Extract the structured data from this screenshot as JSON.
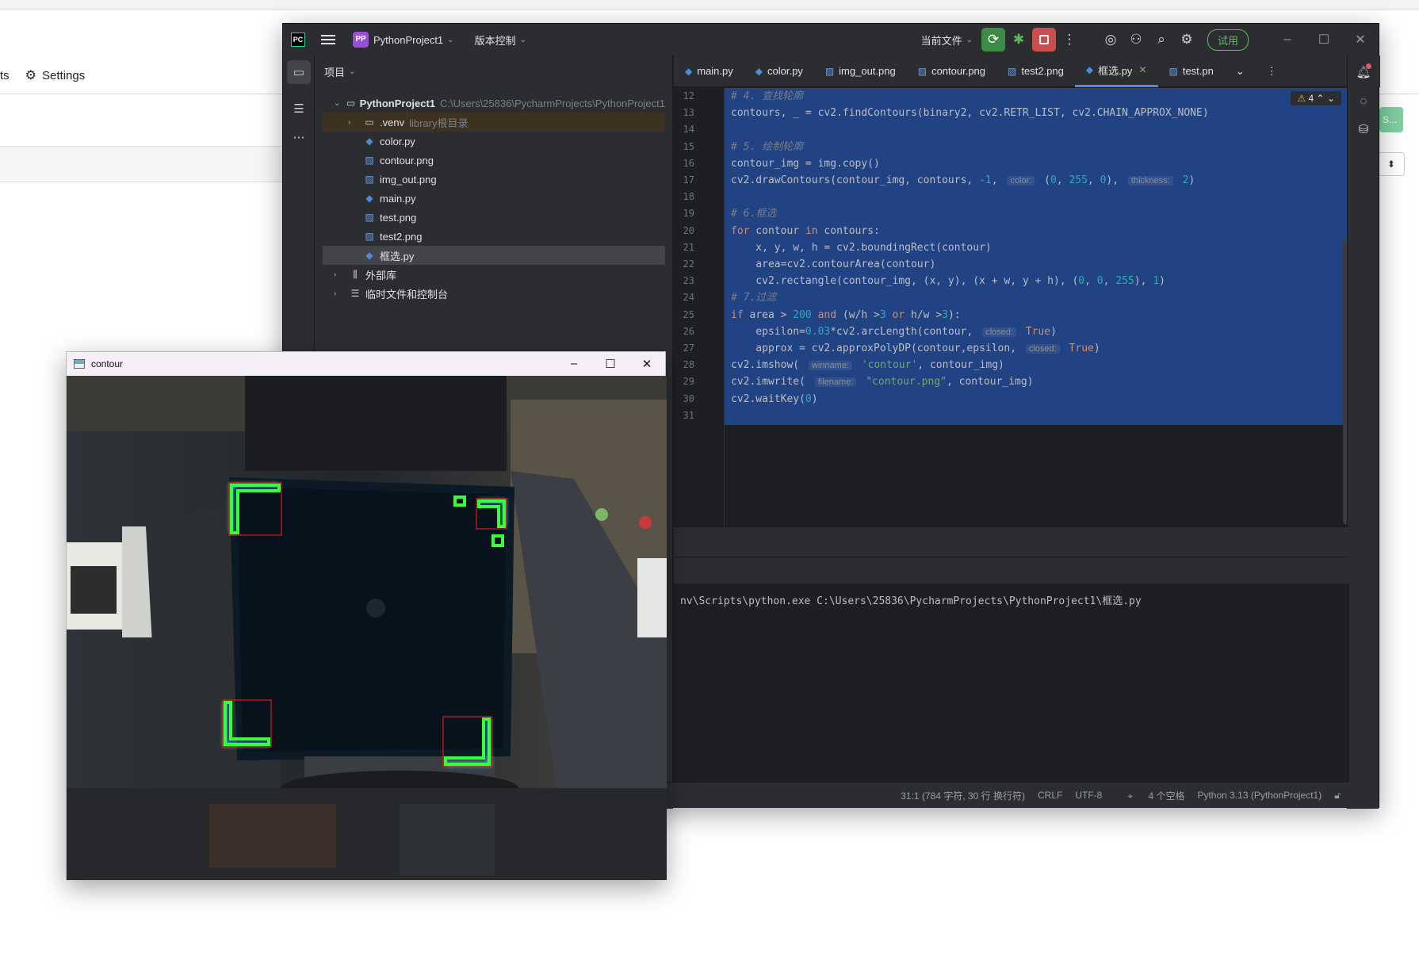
{
  "browser": {
    "nav_left": "ts",
    "nav_settings": "Settings",
    "green_btn": "S..."
  },
  "ide": {
    "logo": "PC",
    "project_badge": "PP",
    "project_name": "PythonProject1",
    "vcs": "版本控制",
    "run_config": "当前文件",
    "trial": "试用",
    "panel_title": "项目",
    "tree": [
      {
        "label": "PythonProject1",
        "path": "C:\\Users\\25836\\PycharmProjects\\PythonProject1",
        "type": "root"
      },
      {
        "label": ".venv",
        "extra": "library根目录",
        "type": "folder"
      },
      {
        "label": "color.py",
        "type": "py"
      },
      {
        "label": "contour.png",
        "type": "png"
      },
      {
        "label": "img_out.png",
        "type": "png"
      },
      {
        "label": "main.py",
        "type": "py"
      },
      {
        "label": "test.png",
        "type": "png"
      },
      {
        "label": "test2.png",
        "type": "png"
      },
      {
        "label": "框选.py",
        "type": "py"
      },
      {
        "label": "外部库",
        "type": "lib"
      },
      {
        "label": "临时文件和控制台",
        "type": "scratch"
      }
    ],
    "tabs": [
      {
        "label": "main.py",
        "type": "py"
      },
      {
        "label": "color.py",
        "type": "py"
      },
      {
        "label": "img_out.png",
        "type": "png"
      },
      {
        "label": "contour.png",
        "type": "png"
      },
      {
        "label": "test2.png",
        "type": "png"
      },
      {
        "label": "框选.py",
        "type": "py",
        "active": true
      },
      {
        "label": "test.pn",
        "type": "png"
      }
    ],
    "warnings": "4",
    "line_numbers": [
      "12",
      "13",
      "14",
      "15",
      "16",
      "17",
      "18",
      "19",
      "20",
      "21",
      "22",
      "23",
      "24",
      "25",
      "26",
      "27",
      "28",
      "29",
      "30",
      "31"
    ],
    "code": [
      "# 4. 查找轮廓",
      "contours, _ = cv2.findContours(binary2, cv2.RETR_LIST, cv2.CHAIN_APPROX_NONE)",
      "",
      "# 5. 绘制轮廓",
      "contour_img = img.copy()",
      "cv2.drawContours(contour_img, contours, -1, color: (0, 255, 0), thickness: 2)",
      "",
      "# 6.框选",
      "for contour in contours:",
      "    x, y, w, h = cv2.boundingRect(contour)",
      "    area=cv2.contourArea(contour)",
      "    cv2.rectangle(contour_img, (x, y), (x + w, y + h), (0, 0, 255), 1)",
      "# 7.过滤",
      "if area > 200 and (w/h >3 or h/w >3):",
      "    epsilon=0.03*cv2.arcLength(contour, closed: True)",
      "    approx = cv2.approxPolyDP(contour,epsilon, closed: True)",
      "cv2.imshow( winname: 'contour', contour_img)",
      "cv2.imwrite( filename: \"contour.png\", contour_img)",
      "cv2.waitKey(0)",
      ""
    ],
    "run_output": "nv\\Scripts\\python.exe C:\\Users\\25836\\PycharmProjects\\PythonProject1\\框选.py",
    "status": {
      "position": "31:1 (784 字符, 30 行 换行符)",
      "line_sep": "CRLF",
      "encoding": "UTF-8",
      "indent": "4 个空格",
      "interpreter": "Python 3.13 (PythonProject1)"
    }
  },
  "contour_window": {
    "title": "contour"
  },
  "colors": {
    "selection": "#214283",
    "accent": "#4a88f0",
    "contour_green": "#39ff3a"
  }
}
